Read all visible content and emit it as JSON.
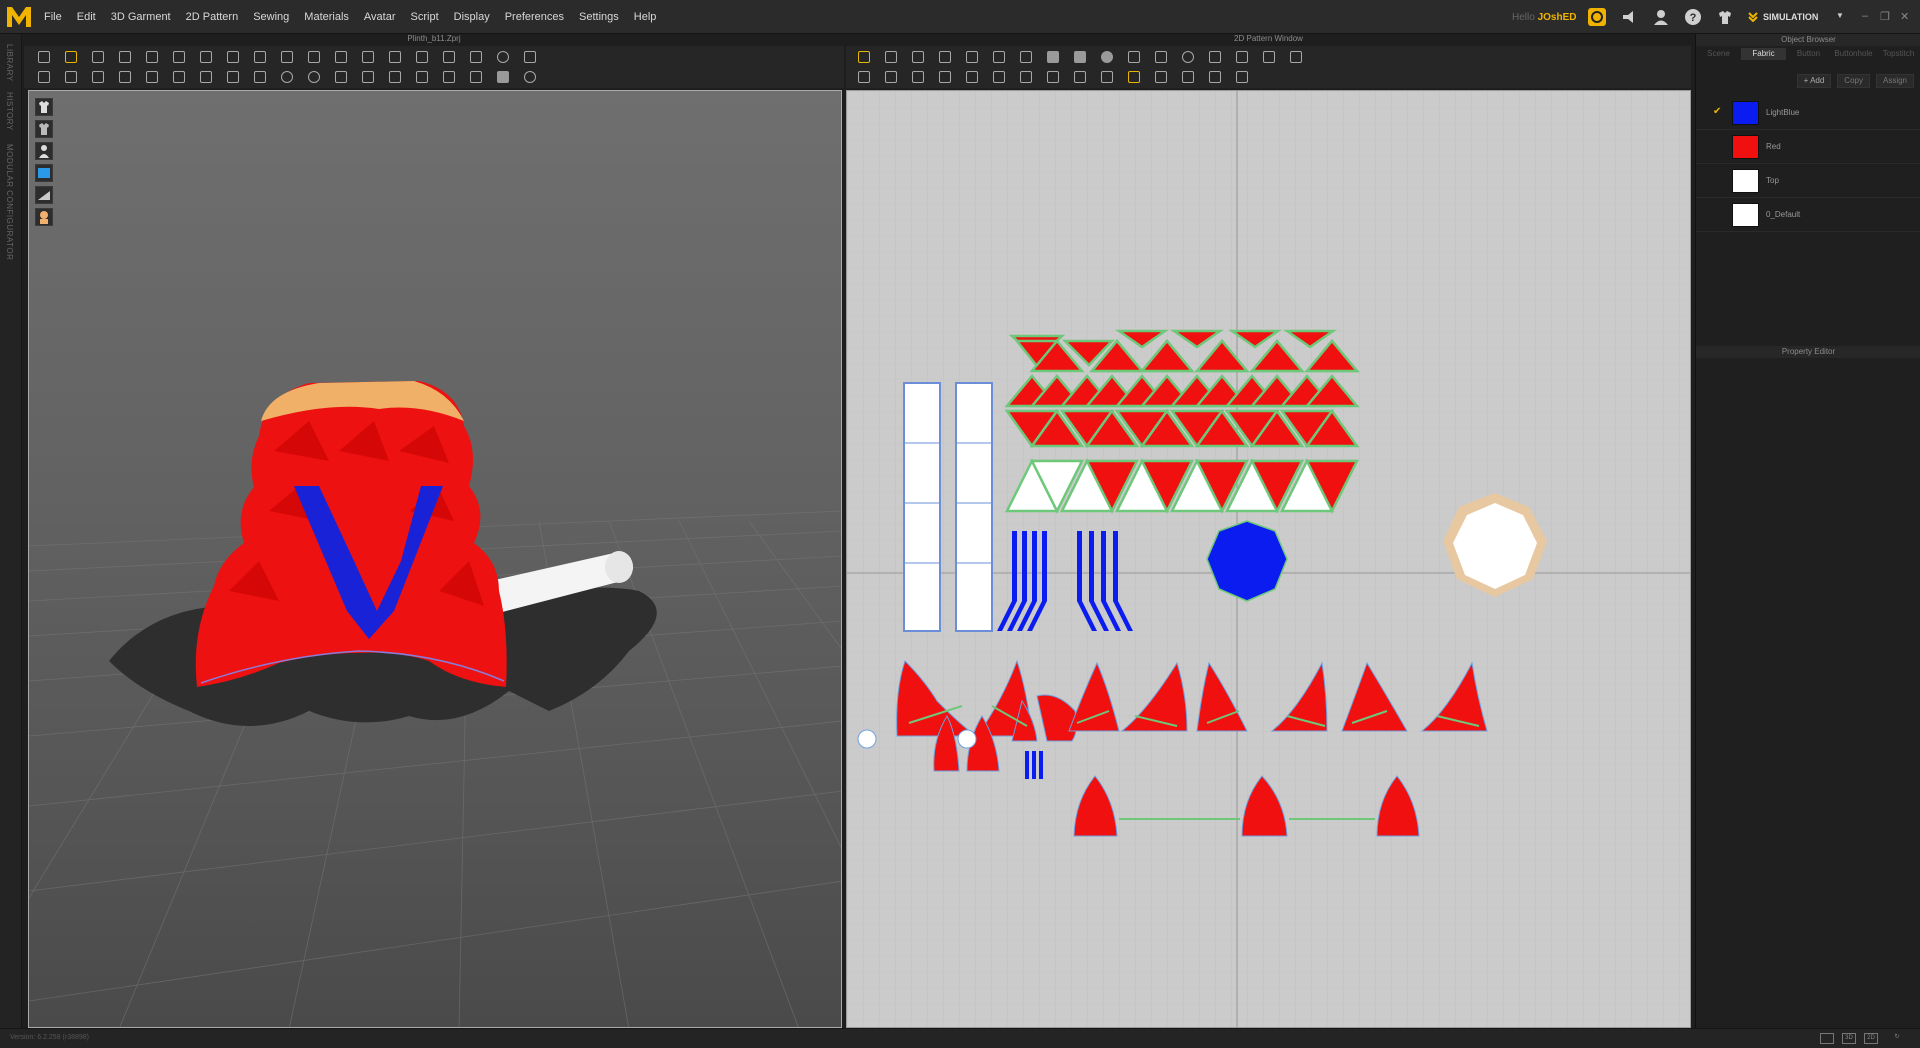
{
  "menu": {
    "items": [
      "File",
      "Edit",
      "3D Garment",
      "2D Pattern",
      "Sewing",
      "Materials",
      "Avatar",
      "Script",
      "Display",
      "Preferences",
      "Settings",
      "Help"
    ]
  },
  "user": {
    "greeting": "Hello",
    "name": "JOshED"
  },
  "mode": {
    "label": "SIMULATION"
  },
  "panels": {
    "view3d_title": "Plinth_b11.Zprj",
    "view2d_title": "2D Pattern Window",
    "object_browser_title": "Object Browser",
    "property_editor_title": "Property Editor"
  },
  "left_tabs": [
    "LIBRARY",
    "HISTORY",
    "MODULAR CONFIGURATOR"
  ],
  "object_browser": {
    "tabs": [
      "Scene",
      "Fabric",
      "Button",
      "Buttonhole",
      "Topstitch"
    ],
    "active_tab": "Fabric",
    "actions": [
      "+ Add",
      "Copy",
      "Assign"
    ],
    "fabrics": [
      {
        "name": "LightBlue",
        "color": "#0b1cf0",
        "checked": true
      },
      {
        "name": "Red",
        "color": "#f01010",
        "checked": false
      },
      {
        "name": "Top",
        "color": "#ffffff",
        "checked": false
      },
      {
        "name": "0_Default",
        "color": "#ffffff",
        "checked": false
      }
    ]
  },
  "status": {
    "version": "Version: 6.2.258 (r38898)"
  },
  "colors": {
    "accent": "#e8b800",
    "red": "#f01010",
    "blue": "#0b1cf0",
    "seam": "#6ec87a"
  }
}
